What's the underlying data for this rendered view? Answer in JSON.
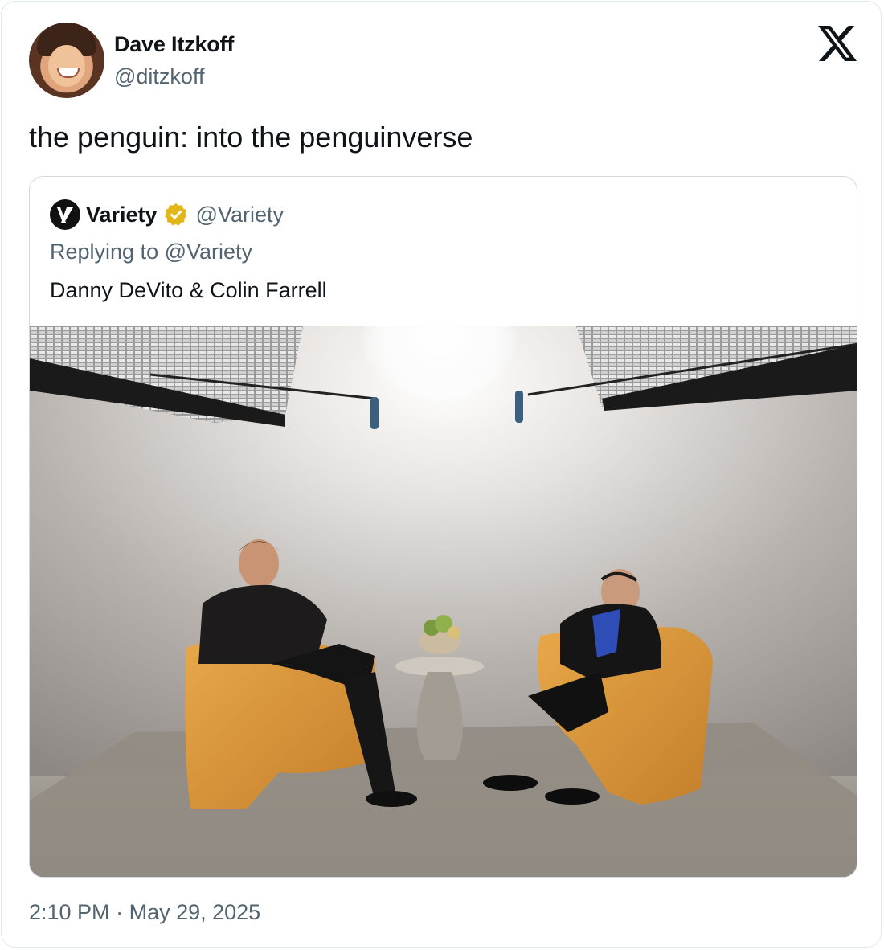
{
  "author": {
    "display_name": "Dave Itzkoff",
    "handle": "@ditzkoff"
  },
  "tweet": {
    "text": "the penguin: into the penguinverse",
    "time": "2:10 PM",
    "separator": "·",
    "date": "May 29, 2025"
  },
  "quoted": {
    "display_name": "Variety",
    "handle": "@Variety",
    "reply_line": "Replying to @Variety",
    "text": "Danny DeVito & Colin Farrell",
    "verified_color": "#e2b719"
  },
  "icons": {
    "platform": "x-logo-icon",
    "quoted_avatar": "variety-logo-icon",
    "verified": "verified-badge-icon"
  },
  "colors": {
    "text": "#0f1419",
    "muted": "#536471",
    "border": "#cfd9de"
  }
}
